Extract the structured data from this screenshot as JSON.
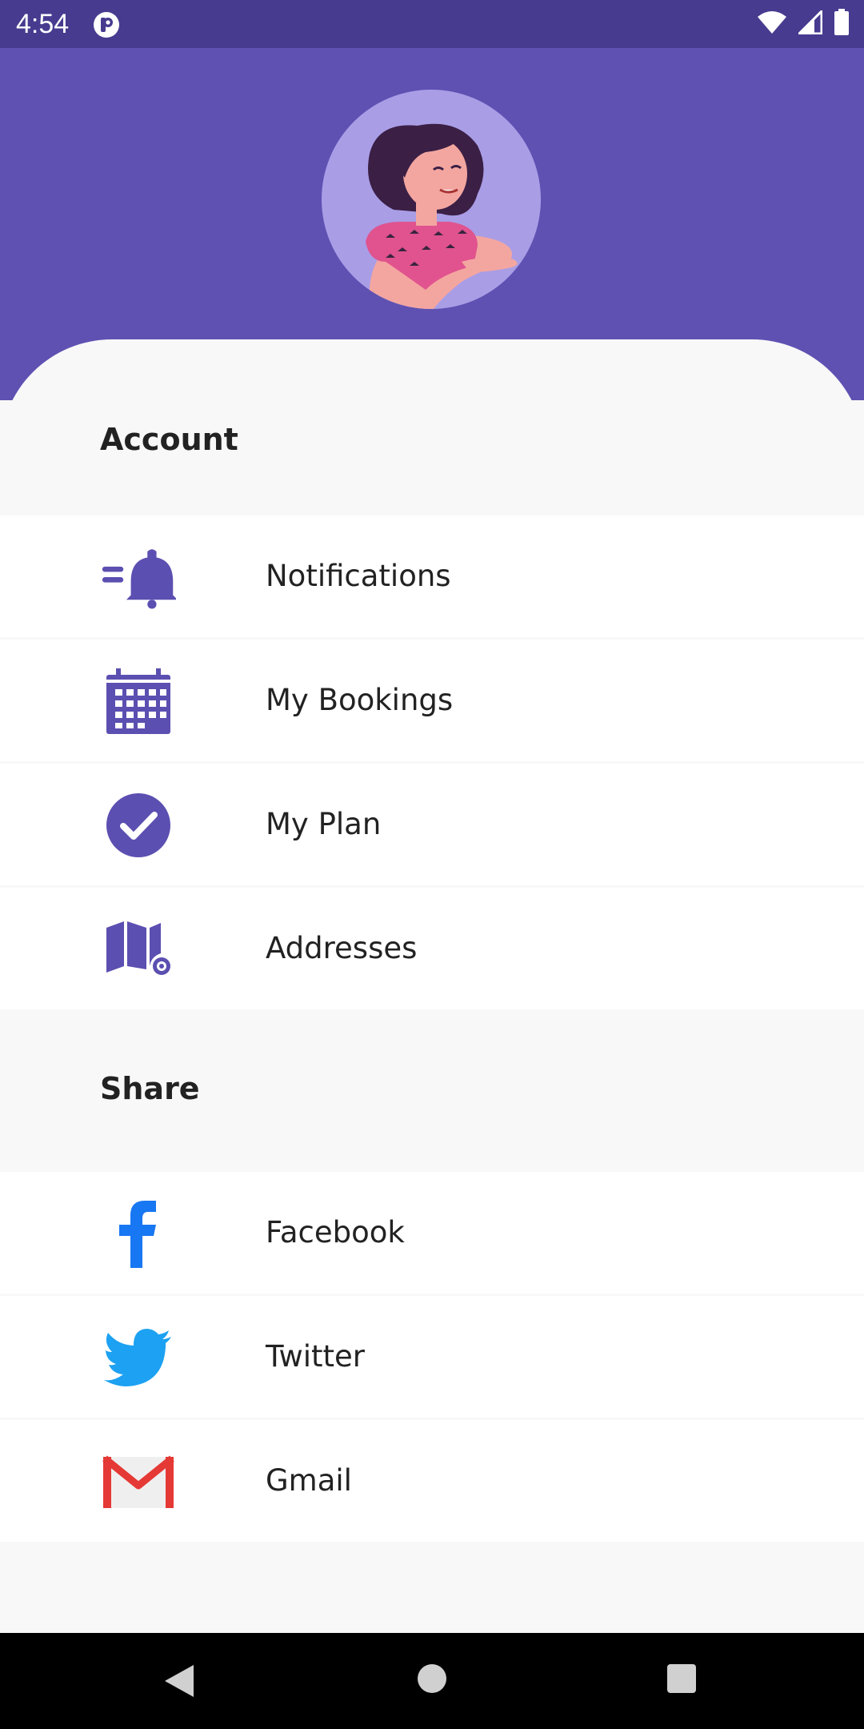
{
  "status_bar": {
    "time": "4:54"
  },
  "account": {
    "title": "Account",
    "items": [
      {
        "label": "Notifications",
        "icon": "bell-icon"
      },
      {
        "label": "My Bookings",
        "icon": "calendar-icon"
      },
      {
        "label": "My Plan",
        "icon": "check-circle-icon"
      },
      {
        "label": "Addresses",
        "icon": "map-icon"
      }
    ]
  },
  "share": {
    "title": "Share",
    "items": [
      {
        "label": "Facebook",
        "icon": "facebook-icon"
      },
      {
        "label": "Twitter",
        "icon": "twitter-icon"
      },
      {
        "label": "Gmail",
        "icon": "gmail-icon"
      }
    ]
  },
  "colors": {
    "header": "#5e51b2",
    "status_bar": "#463b8f",
    "accent": "#5b4fb1",
    "facebook": "#1877f2",
    "twitter": "#1da1f2",
    "gmail": "#e53935"
  }
}
